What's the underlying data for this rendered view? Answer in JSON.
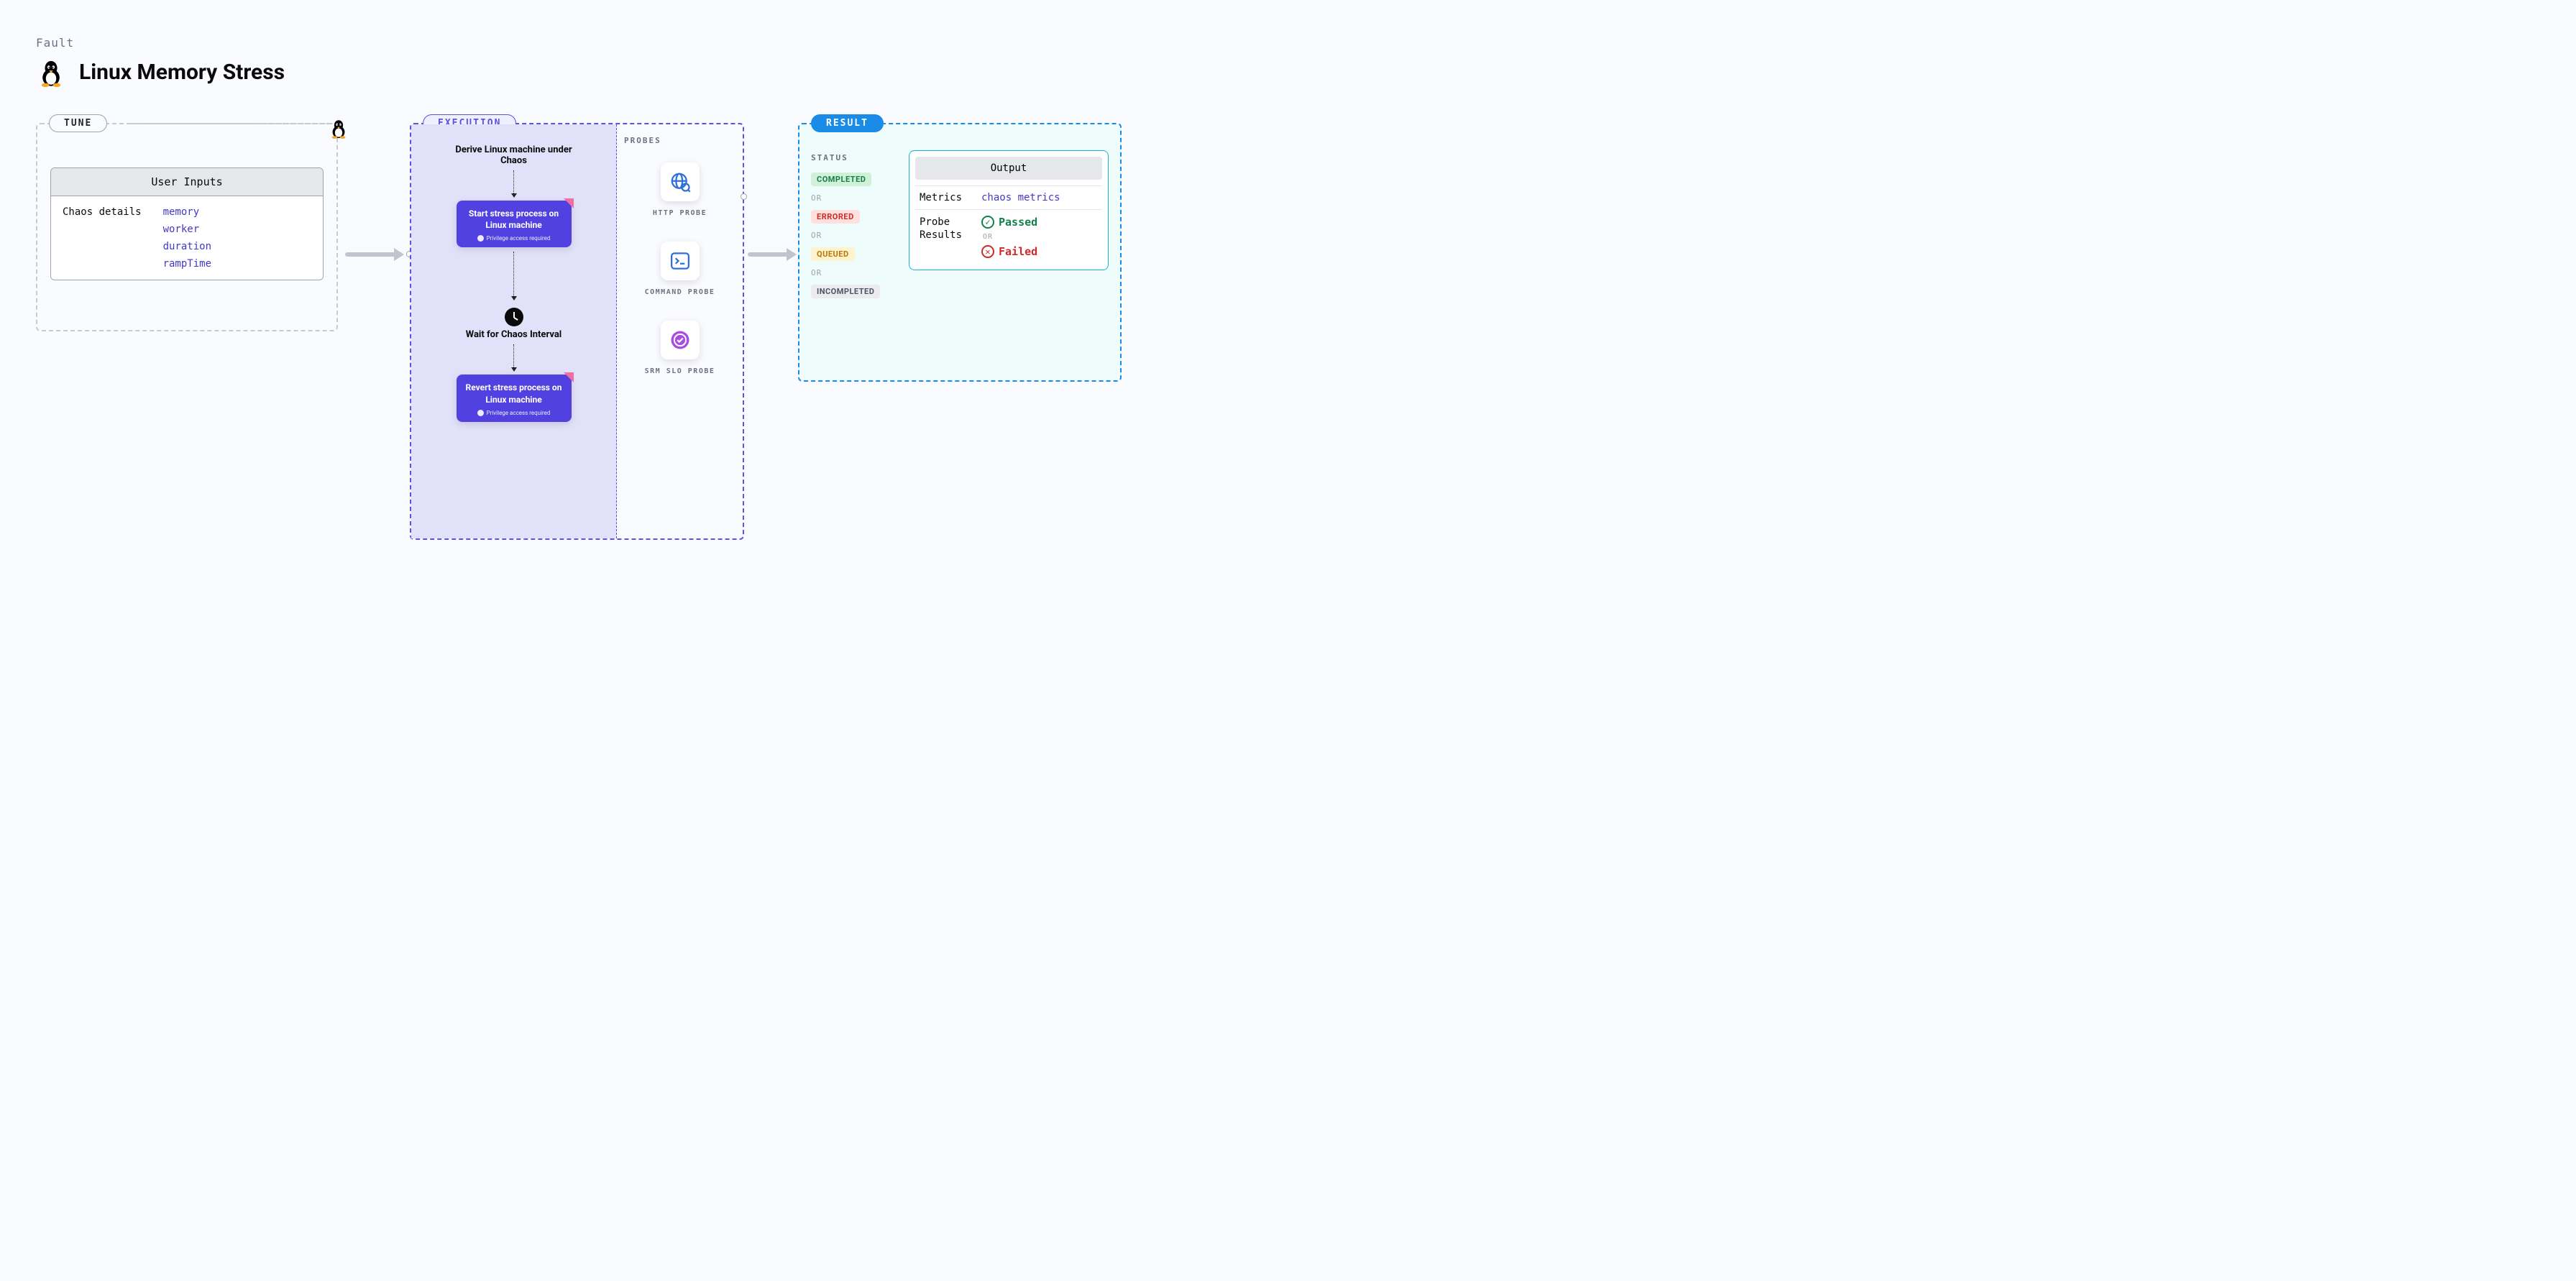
{
  "header": {
    "category": "Fault",
    "title": "Linux Memory Stress"
  },
  "tune": {
    "pill": "TUNE",
    "card_title": "User Inputs",
    "row_label": "Chaos details",
    "items": [
      "memory",
      "worker",
      "duration",
      "rampTime"
    ]
  },
  "execution": {
    "pill": "EXECUTION",
    "derive": "Derive Linux machine under Chaos",
    "step1_title": "Start stress process on Linux machine",
    "step1_sub": "Privilege access required",
    "wait": "Wait for Chaos Interval",
    "step2_title": "Revert stress process on Linux machine",
    "step2_sub": "Privilege access required",
    "probes_label": "PROBES",
    "probes": [
      {
        "name": "HTTP PROBE"
      },
      {
        "name": "COMMAND PROBE"
      },
      {
        "name": "SRM SLO PROBE"
      }
    ]
  },
  "result": {
    "pill": "RESULT",
    "status_label": "STATUS",
    "or": "OR",
    "badges": {
      "completed": "COMPLETED",
      "errored": "ERRORED",
      "queued": "QUEUED",
      "incompleted": "INCOMPLETED"
    },
    "output": {
      "title": "Output",
      "metrics_k": "Metrics",
      "metrics_v": "chaos metrics",
      "probe_k": "Probe Results",
      "passed": "Passed",
      "failed": "Failed"
    }
  }
}
